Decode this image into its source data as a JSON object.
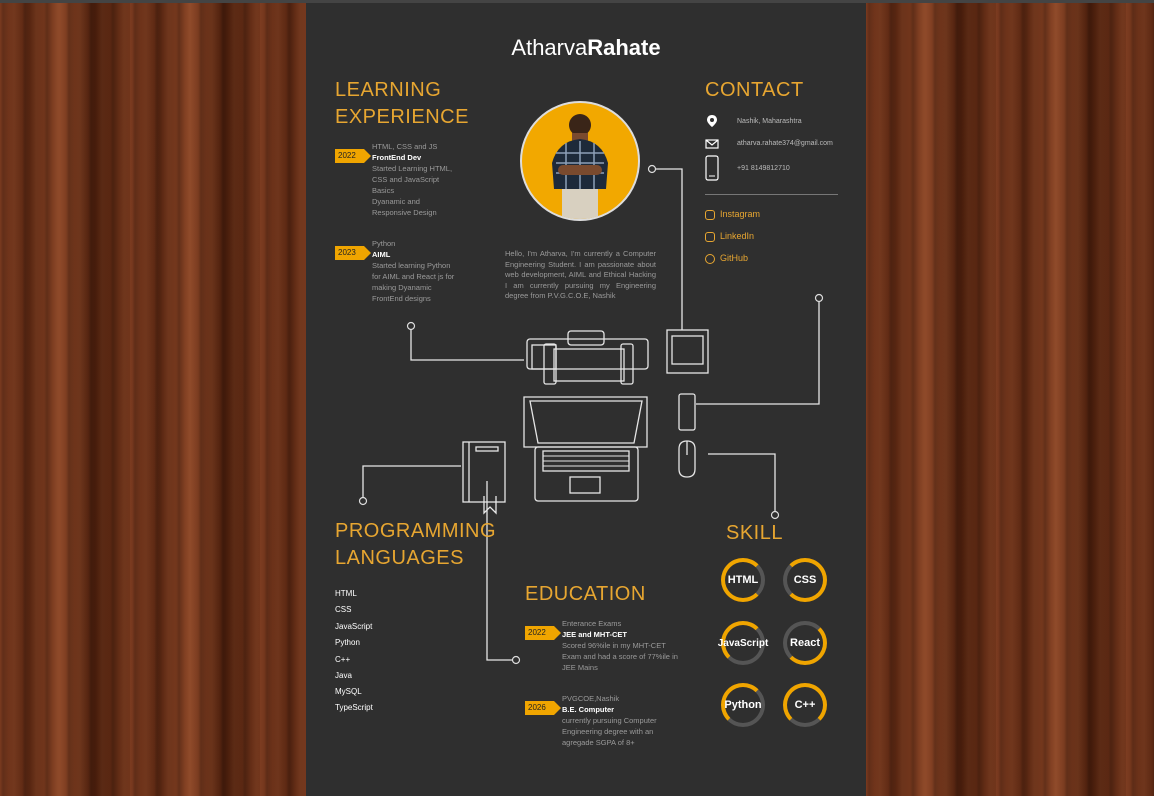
{
  "name": {
    "first": "Atharva",
    "last": "Rahate"
  },
  "experience": {
    "heading1": "LEARNING",
    "heading2": "EXPERIENCE",
    "items": [
      {
        "year": "2022",
        "subtitle": "HTML, CSS and JS",
        "title": "FrontEnd Dev",
        "desc": [
          "Started Learning HTML,",
          "CSS and JavaScript",
          "Basics",
          "Dyanamic and",
          "Responsive Design"
        ]
      },
      {
        "year": "2023",
        "subtitle": "Python",
        "title": "AIML",
        "desc": [
          "Started learning Python",
          "for AIML and React js for",
          "making Dyanamic",
          "FrontEnd designs"
        ]
      }
    ]
  },
  "about": "Hello, I'm Atharva, I'm currently a Computer Engineering Student. I am passionate about web development, AIML and Ethical Hacking I am currently pursuing my Engineering degree from P.V.G.C.O.E, Nashik",
  "contact": {
    "heading": "CONTACT",
    "location": "Nashik, Maharashtra",
    "email": "atharva.rahate374@gmail.com",
    "phone": "+91 8149812710",
    "socials": [
      "Instagram",
      "LinkedIn",
      "GitHub"
    ]
  },
  "languages": {
    "heading1": "PROGRAMMING",
    "heading2": "LANGUAGES",
    "items": [
      "HTML",
      "CSS",
      "JavaScript",
      "Python",
      "C++",
      "Java",
      "MySQL",
      "TypeScript"
    ]
  },
  "education": {
    "heading": "EDUCATION",
    "items": [
      {
        "year": "2022",
        "subtitle": "Enterance Exams",
        "title": "JEE and MHT-CET",
        "desc": [
          "Scored 96%ile in my MHT-CET",
          "Exam and had a score of 77%ile in",
          "JEE Mains"
        ]
      },
      {
        "year": "2026",
        "subtitle": "PVGCOE,Nashik",
        "title": "B.E. Computer",
        "desc": [
          "currently pursuing Computer",
          "Engineering degree with an",
          "agregade SGPA of 8+"
        ]
      }
    ]
  },
  "skills": {
    "heading": "SKILL",
    "items": [
      "HTML",
      "CSS",
      "JavaScript",
      "React",
      "Python",
      "C++"
    ]
  },
  "colors": {
    "accent": "#f0a500",
    "card": "#2f2f2f"
  }
}
